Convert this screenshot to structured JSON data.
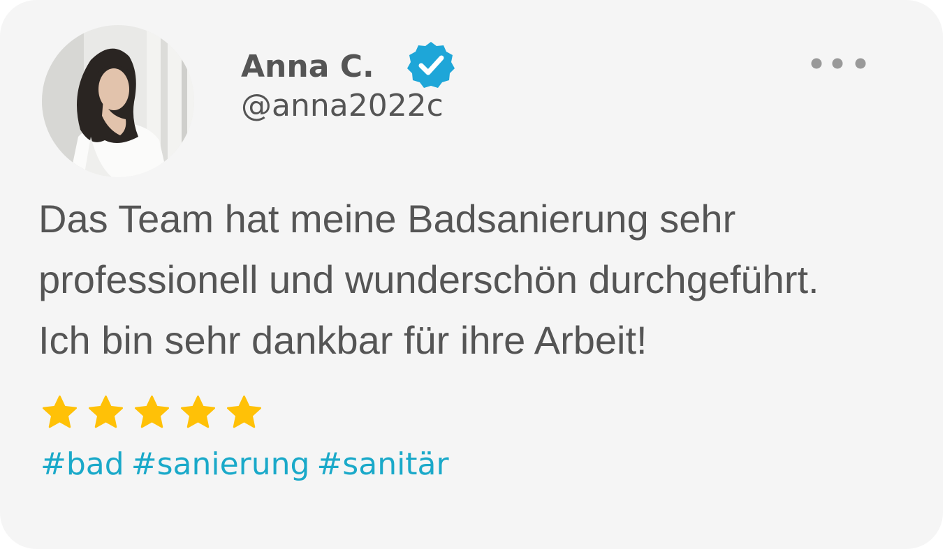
{
  "author": {
    "name": "Anna C.",
    "handle": "@anna2022c",
    "verified": true,
    "avatar_icon": "profile-photo"
  },
  "menu_icon": "more-horizontal-icon",
  "review": {
    "lines": [
      "Das Team hat meine Badsanierung sehr",
      "professionell und wunderschön durchgeführt.",
      "Ich bin sehr dankbar für ihre Arbeit!"
    ],
    "rating": 5,
    "rating_max": 5
  },
  "hashtags": [
    "#bad",
    "#sanierung",
    "#sanitär"
  ],
  "colors": {
    "card_background": "#f5f5f5",
    "text": "#555555",
    "verified_badge": "#1ea6d8",
    "star": "#ffc107",
    "hashtag": "#1aa9c9",
    "menu_dots": "#999999"
  }
}
